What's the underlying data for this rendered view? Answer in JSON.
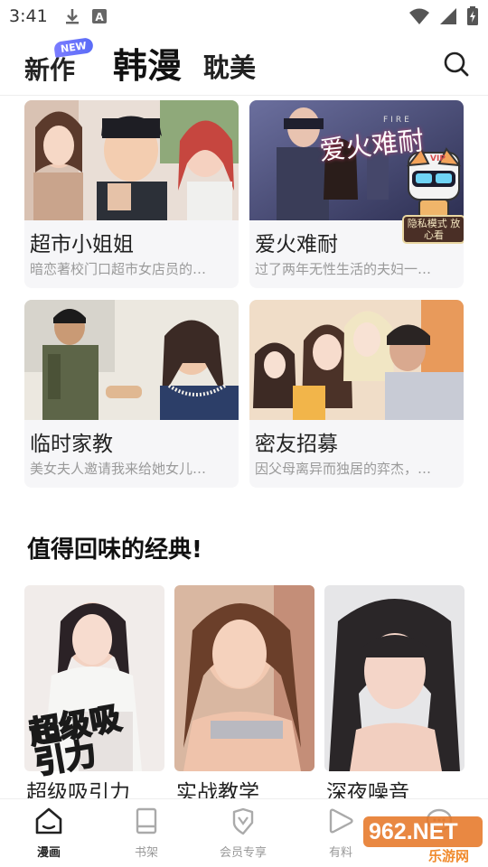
{
  "status_bar": {
    "time": "3:41",
    "left_icons": [
      "download-icon",
      "font-a-icon"
    ],
    "right_icons": [
      "wifi-icon",
      "signal-icon",
      "battery-charging-icon"
    ]
  },
  "top_nav": {
    "tabs": [
      {
        "label": "新作",
        "badge": "NEW"
      },
      {
        "label": "韩漫",
        "active": true
      },
      {
        "label": "耽美"
      }
    ],
    "search_icon": "search-icon"
  },
  "featured": [
    {
      "title": "超市小姐姐",
      "desc": "暗恋著校门口超市女店员的…"
    },
    {
      "title": "爱火难耐",
      "desc": "过了两年无性生活的夫妇一…",
      "cover_text": "爱火难耐",
      "cover_sub": "FIRE",
      "sticker": "VIP",
      "sticker_sign": "隐私模式 放心看"
    },
    {
      "title": "临时家教",
      "desc": "美女夫人邀请我来给她女儿…"
    },
    {
      "title": "密友招募",
      "desc": "因父母离异而独居的弈杰，…"
    }
  ],
  "classics": {
    "heading": "值得回味的经典!",
    "items": [
      {
        "title": "超级吸引力",
        "cover_text": "超级吸引力"
      },
      {
        "title": "实战教学"
      },
      {
        "title": "深夜噪音"
      }
    ]
  },
  "bottom_nav": [
    {
      "label": "漫画",
      "icon": "home-icon",
      "active": true
    },
    {
      "label": "书架",
      "icon": "book-icon"
    },
    {
      "label": "会员专享",
      "icon": "vip-shield-icon"
    },
    {
      "label": "有料",
      "icon": "play-triangle-icon"
    },
    {
      "label": "",
      "icon": "chat-bubble-icon"
    }
  ],
  "watermark": {
    "text": "962.NET",
    "sub": "乐游网"
  },
  "colors": {
    "accent_blue": "#5a6cf7",
    "text_dark": "#222222",
    "text_gray": "#9a9a9a",
    "card_bg": "#f6f6f8"
  }
}
